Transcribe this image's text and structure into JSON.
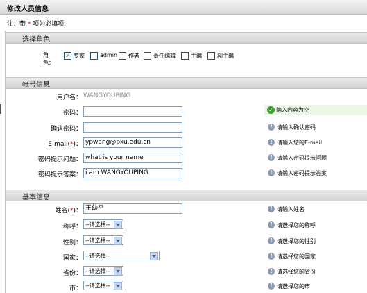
{
  "title": "修改人员信息",
  "note": {
    "prefix": "注：带",
    "star": "*",
    "suffix": "项为必填项"
  },
  "sections": {
    "role": "选择角色",
    "account": "帐号信息",
    "basic": "基本信息"
  },
  "role": {
    "label": "角色：",
    "options": [
      {
        "label": "专家",
        "checked": true
      },
      {
        "label": "admin",
        "checked": false
      },
      {
        "label": "作者",
        "checked": false
      },
      {
        "label": "责任编辑",
        "checked": false
      },
      {
        "label": "主编",
        "checked": false
      },
      {
        "label": "副主编",
        "checked": false
      }
    ]
  },
  "account": {
    "username_label": "用户名：",
    "username_value": "WANGYOUPING",
    "password_label": "密码：",
    "password_hint": "输入内容为空",
    "confirm_label": "确认密码：",
    "confirm_hint": "请输入确认密码",
    "email_label_pre": "E-mail(",
    "email_label_star": "*",
    "email_label_post": ")：",
    "email_value": "ypwang@pku.edu.cn",
    "email_hint": "请输入您的E-mail",
    "question_label": "密码提示问题：",
    "question_value": "what is your name",
    "question_hint": "请输入密码提示问题",
    "answer_label": "密码提示答案：",
    "answer_value": "i am WANGYOUPING",
    "answer_hint": "请输入密码提示答案"
  },
  "basic": {
    "name_label_pre": "姓名(",
    "name_label_star": "*",
    "name_label_post": ")：",
    "name_value": "王幼平",
    "name_hint": "请输入姓名",
    "title_label": "称呼：",
    "title_value": "--请选择--",
    "title_hint": "请选择您的称呼",
    "gender_label": "性别：",
    "gender_value": "--请选择--",
    "gender_hint": "请选择您的性别",
    "country_label": "国家：",
    "country_value": "--请选择--",
    "country_hint": "请选择您的国家",
    "province_label": "省份：",
    "province_value": "--请选择--",
    "province_hint": "请选择您的省份",
    "city_label": "市：",
    "city_value": "--请选择--",
    "city_hint": "请选择您的市"
  },
  "icons": {
    "info": "info-icon",
    "ok": "check-circle-icon",
    "checkbox": "checkbox-icon"
  },
  "colors": {
    "required": "#e01010",
    "ok": "#3a9e2e",
    "info": "#8b9bb1",
    "input_border": "#7f9db9"
  }
}
